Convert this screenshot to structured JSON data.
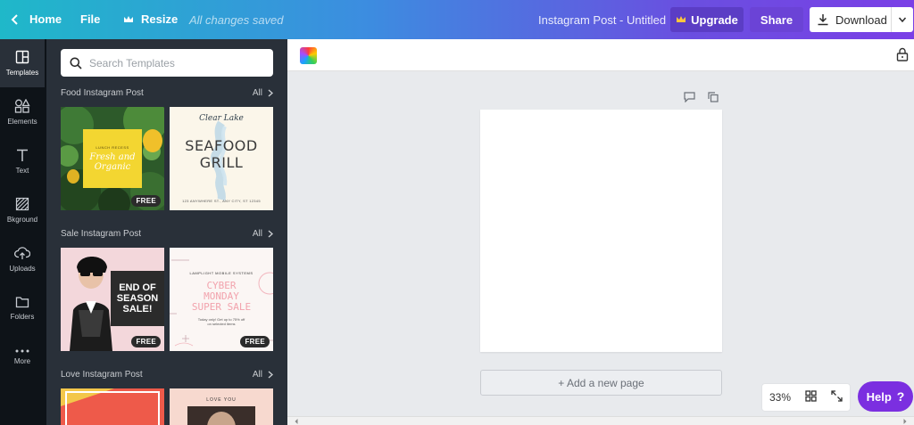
{
  "topbar": {
    "home_label": "Home",
    "file_label": "File",
    "resize_label": "Resize",
    "saved_status": "All changes saved",
    "design_title": "Instagram Post - Untitled",
    "upgrade_label": "Upgrade",
    "share_label": "Share",
    "download_label": "Download"
  },
  "leftnav": {
    "items": [
      {
        "label": "Templates",
        "icon": "layout-icon"
      },
      {
        "label": "Elements",
        "icon": "shapes-icon"
      },
      {
        "label": "Text",
        "icon": "text-icon"
      },
      {
        "label": "Bkground",
        "icon": "background-icon"
      },
      {
        "label": "Uploads",
        "icon": "upload-icon"
      },
      {
        "label": "Folders",
        "icon": "folder-icon"
      },
      {
        "label": "More",
        "icon": "more-icon"
      }
    ]
  },
  "panel": {
    "search_placeholder": "Search Templates",
    "sections": [
      {
        "title": "Food Instagram Post",
        "all_label": "All"
      },
      {
        "title": "Sale Instagram Post",
        "all_label": "All"
      },
      {
        "title": "Love Instagram Post",
        "all_label": "All"
      }
    ],
    "free_label": "FREE",
    "templates": {
      "organic_small": "LUNCH RECESS",
      "organic_line1": "Fresh and",
      "organic_line2": "Organic",
      "seafood_script": "Clear Lake",
      "seafood_line1": "SEAFOOD",
      "seafood_line2": "GRILL",
      "seafood_address": "123 ANYWHERE ST., ANY CITY, ST 12345",
      "season_line1": "END OF",
      "season_line2": "SEASON",
      "season_line3": "SALE!",
      "cyber_brand": "LAMPLIGHT MOBILE SYSTEMS",
      "cyber_line1": "CYBER",
      "cyber_line2": "MONDAY",
      "cyber_line3": "SUPER SALE",
      "cyber_sub1": "Today only! Get up to 75% off",
      "cyber_sub2": "on selected items",
      "love_text": "LOVE YOU"
    }
  },
  "canvas": {
    "add_page_label": "+ Add a new page",
    "zoom": "33%",
    "help_label": "Help",
    "help_icon": "?"
  }
}
